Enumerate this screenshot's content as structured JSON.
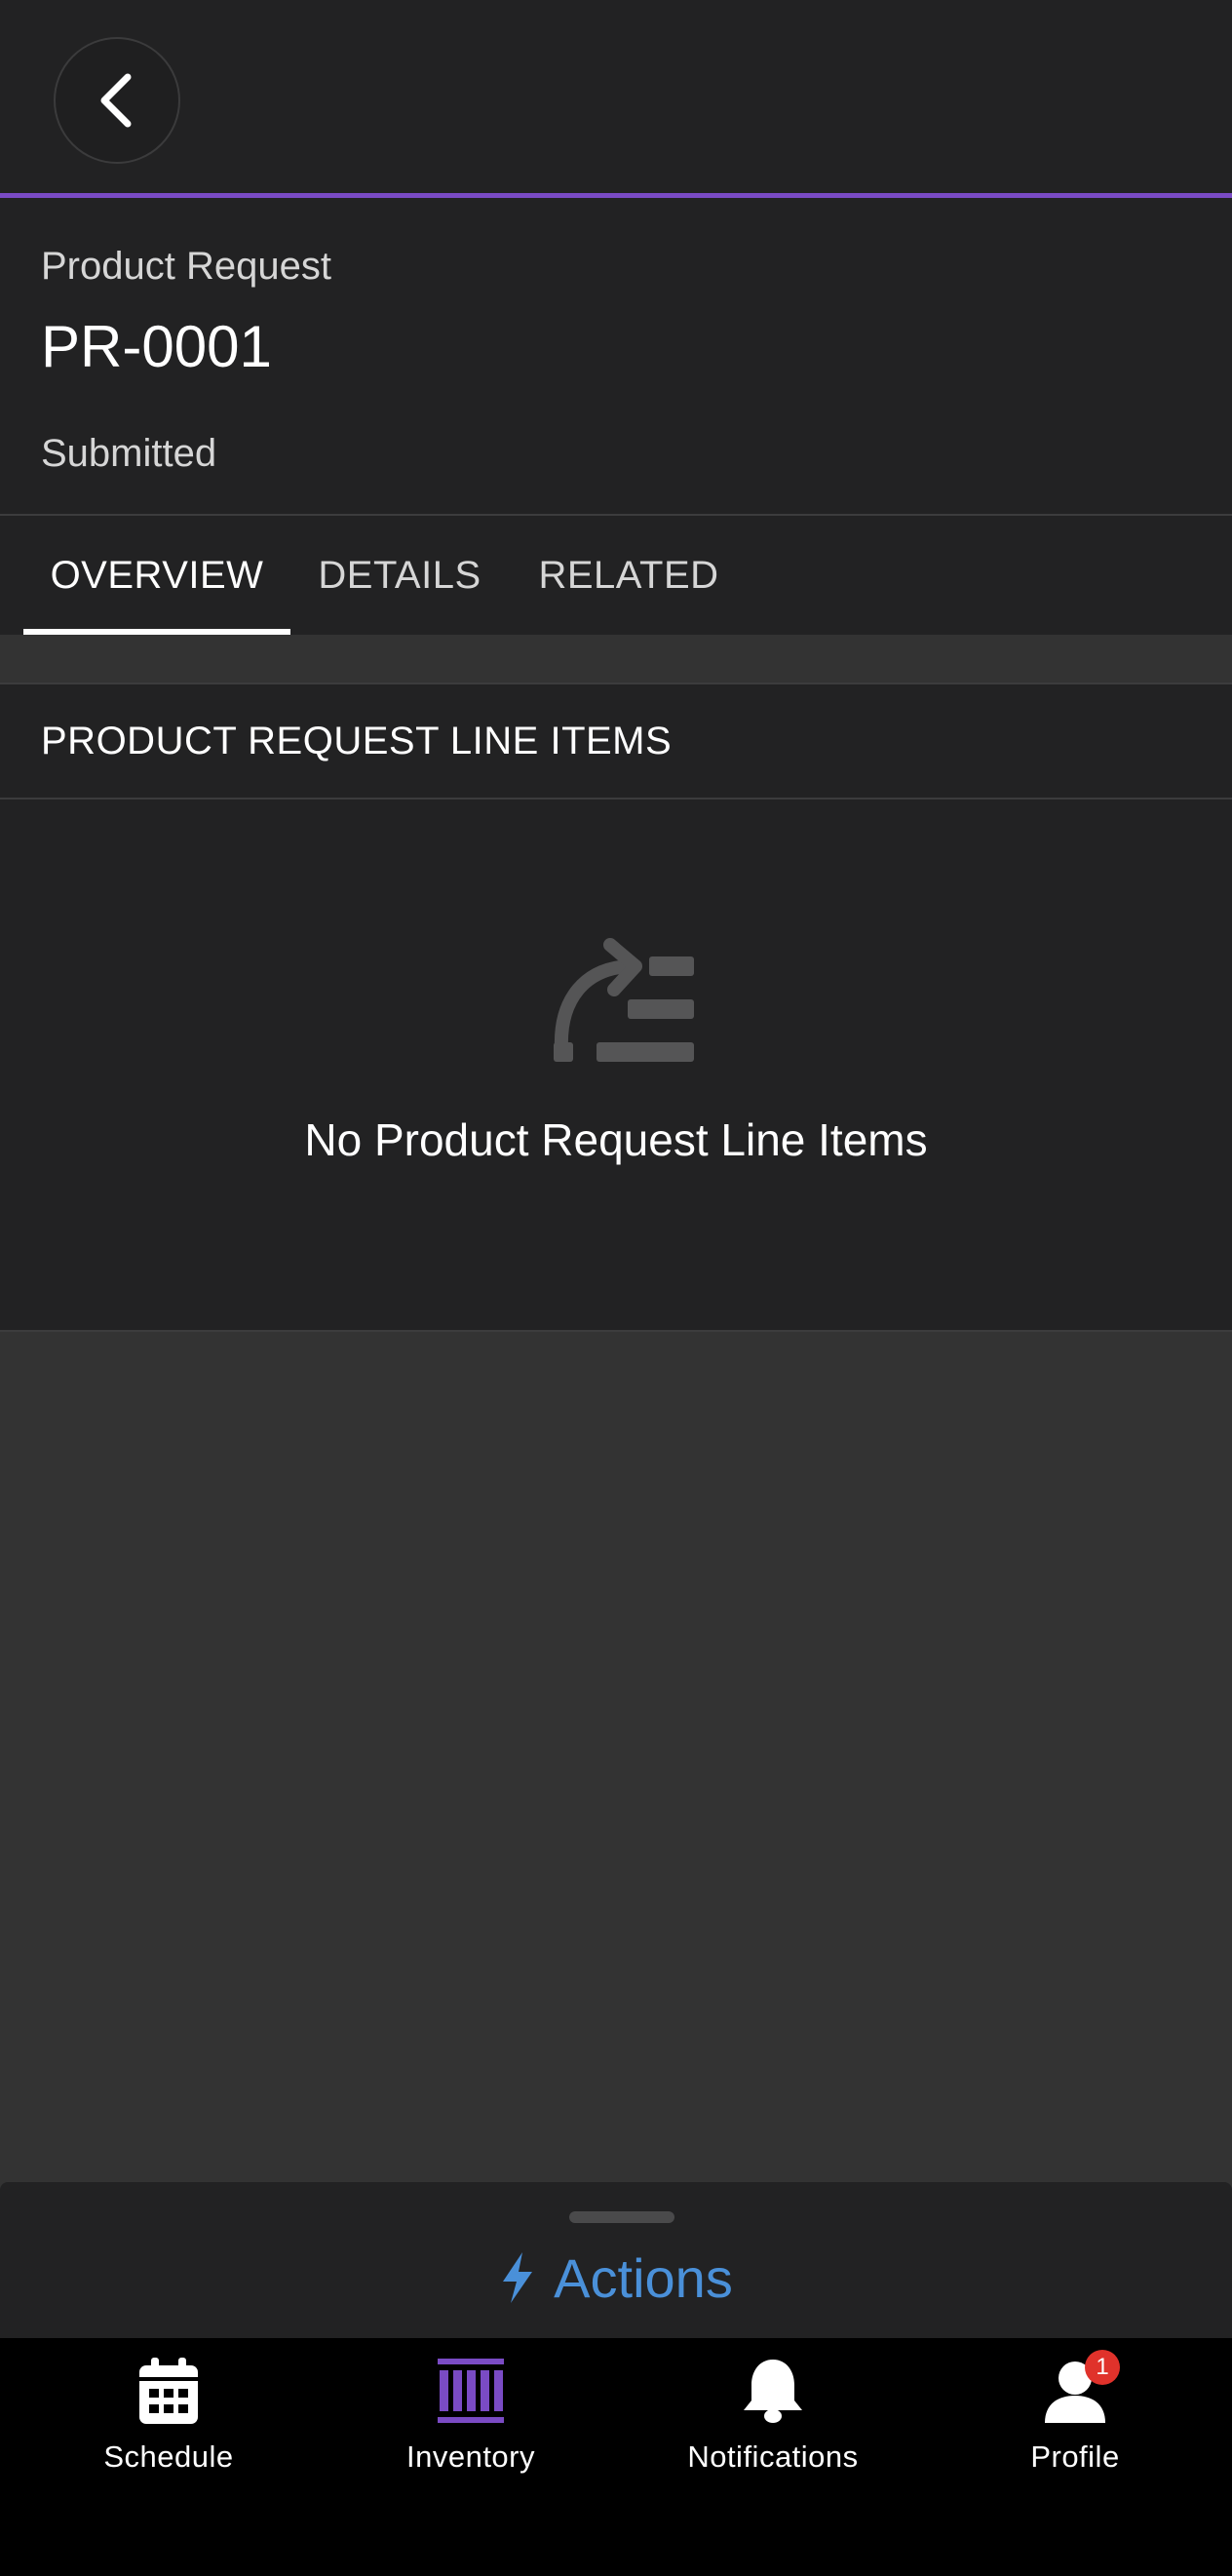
{
  "header": {
    "back_icon": "chevron-left-icon"
  },
  "record": {
    "object_label": "Product Request",
    "title": "PR-0001",
    "status": "Submitted"
  },
  "tabs": [
    {
      "label": "OVERVIEW",
      "active": true
    },
    {
      "label": "DETAILS",
      "active": false
    },
    {
      "label": "RELATED",
      "active": false
    }
  ],
  "section": {
    "title": "PRODUCT REQUEST LINE ITEMS",
    "empty_icon": "empty-list-icon",
    "empty_message": "No Product Request Line Items"
  },
  "actions": {
    "icon": "lightning-bolt-icon",
    "label": "Actions",
    "color": "#4a90d9"
  },
  "bottom_nav": {
    "items": [
      {
        "label": "Schedule",
        "icon": "calendar-icon",
        "active": false
      },
      {
        "label": "Inventory",
        "icon": "barcode-icon",
        "active": true
      },
      {
        "label": "Notifications",
        "icon": "bell-icon",
        "active": false
      },
      {
        "label": "Profile",
        "icon": "user-icon",
        "active": false,
        "badge": "1"
      }
    ]
  },
  "colors": {
    "accent": "#7a4bc4",
    "badge": "#e0322b"
  }
}
